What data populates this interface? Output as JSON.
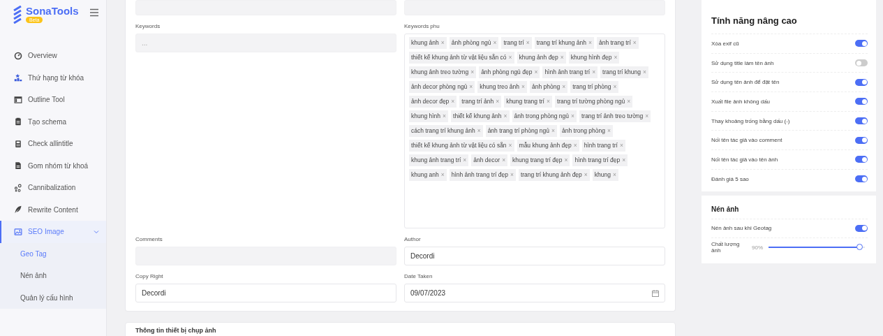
{
  "sidebar": {
    "brand": "SonaTools",
    "badge": "Beta",
    "items": [
      {
        "label": "Overview",
        "selected": false
      },
      {
        "label": "Thứ hạng từ khóa",
        "selected": false
      },
      {
        "label": "Outline Tool",
        "selected": false
      },
      {
        "label": "Tạo schema",
        "selected": false
      },
      {
        "label": "Check allintitle",
        "selected": false
      },
      {
        "label": "Gom nhóm từ khoá",
        "selected": false
      },
      {
        "label": "Cannibalization",
        "selected": false
      },
      {
        "label": "Rewrite Content",
        "selected": false
      },
      {
        "label": "SEO Image",
        "selected": true,
        "expanded": true,
        "children": [
          {
            "label": "Geo Tag",
            "selected": true
          },
          {
            "label": "Nén ảnh",
            "selected": false
          },
          {
            "label": "Quản lý cấu hình",
            "selected": false
          }
        ]
      }
    ]
  },
  "form": {
    "keywords": {
      "label": "Keywords",
      "placeholder": "..."
    },
    "keywords_phu": {
      "label": "Keywords phu",
      "tags": [
        "khung ảnh",
        "ảnh phòng ngủ",
        "trang trí",
        "trang trí khung ảnh",
        "ảnh trang trí",
        "thiết kế khung ảnh từ vật liệu sẵn có",
        "khung ảnh đẹp",
        "khung hình đẹp",
        "khung ảnh treo tường",
        "ảnh phòng ngủ đẹp",
        "hình ảnh trang trí",
        "trang trí khung",
        "ảnh decor phòng ngủ",
        "khung treo ảnh",
        "ảnh phòng",
        "trang trí phòng",
        "ảnh decor đẹp",
        "trang trí ảnh",
        "khung trang trí",
        "trang trí tường phòng ngủ",
        "khung hình",
        "thiết kế khung ảnh",
        "ảnh trong phòng ngủ",
        "trang trí ảnh treo tường",
        "cách trang trí khung ảnh",
        "ảnh trang trí phòng ngủ",
        "ảnh trong phòng",
        "thiết kế khung ảnh từ vật liệu có sẵn",
        "mẫu khung ảnh đẹp",
        "hình trang trí",
        "khung ảnh trang trí",
        "ảnh decor",
        "khung trang trí đẹp",
        "hình trang trí đẹp",
        "khung anh",
        "hình ảnh trang trí đẹp",
        "trang trí khung ảnh đẹp",
        "khung"
      ],
      "remove_glyph": "×"
    },
    "comments": {
      "label": "Comments"
    },
    "author": {
      "label": "Author",
      "value": "Decordi"
    },
    "copy_right": {
      "label": "Copy Right",
      "value": "Decordi"
    },
    "date_taken": {
      "label": "Date Taken",
      "value": "09/07/2023"
    }
  },
  "next_section": {
    "title": "Thông tin thiết bị chụp ảnh"
  },
  "advanced": {
    "title": "Tính năng nâng cao",
    "toggles": [
      {
        "label": "Xóa exif cũ",
        "on": true
      },
      {
        "label": "Sử dụng title làm tên ảnh",
        "on": false
      },
      {
        "label": "Sử dụng tên ảnh để đặt tên",
        "on": true
      },
      {
        "label": "Xuất file ảnh không dấu",
        "on": true
      },
      {
        "label": "Thay khoảng trống bằng dấu (-)",
        "on": true
      },
      {
        "label": "Nối tên tác giả vào comment",
        "on": true
      },
      {
        "label": "Nối tên tác giả vào tên ảnh",
        "on": true
      },
      {
        "label": "Đánh giá 5 sao",
        "on": true
      }
    ]
  },
  "compress": {
    "title": "Nén ảnh",
    "toggles": [
      {
        "label": "Nén ảnh sau khi Geotag",
        "on": true
      }
    ],
    "quality": {
      "label": "Chất lượng ảnh",
      "reading": "90%",
      "level": 0.95
    }
  }
}
